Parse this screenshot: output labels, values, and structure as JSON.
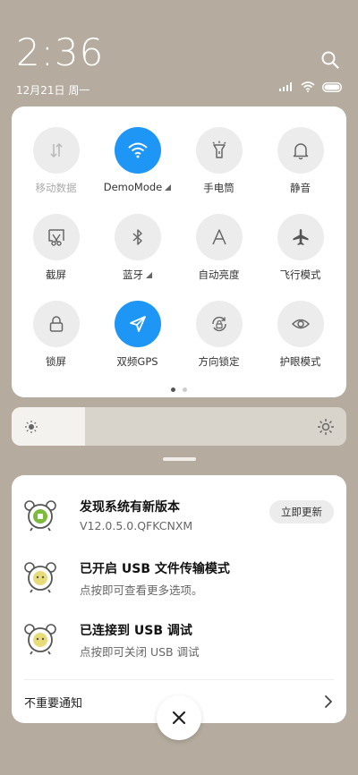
{
  "status": {
    "time": "2:36",
    "date": "12月21日 周一",
    "icons": [
      "signal-icon",
      "wifi-icon",
      "battery-icon"
    ]
  },
  "quick_settings": {
    "tiles": [
      {
        "label": "移动数据",
        "icon": "mobile-data-icon",
        "active": false,
        "disabled": true
      },
      {
        "label": "DemoMode",
        "icon": "wifi-icon",
        "active": true,
        "has_more": true
      },
      {
        "label": "手电筒",
        "icon": "flashlight-icon",
        "active": false
      },
      {
        "label": "静音",
        "icon": "bell-icon",
        "active": false
      },
      {
        "label": "截屏",
        "icon": "screenshot-icon",
        "active": false
      },
      {
        "label": "蓝牙",
        "icon": "bluetooth-icon",
        "active": false,
        "has_more": true
      },
      {
        "label": "自动亮度",
        "icon": "auto-brightness-icon",
        "active": false
      },
      {
        "label": "飞行模式",
        "icon": "airplane-icon",
        "active": false
      },
      {
        "label": "锁屏",
        "icon": "lock-icon",
        "active": false
      },
      {
        "label": "双频GPS",
        "icon": "location-icon",
        "active": true
      },
      {
        "label": "方向锁定",
        "icon": "rotation-lock-icon",
        "active": false
      },
      {
        "label": "护眼模式",
        "icon": "eye-icon",
        "active": false
      }
    ],
    "page_count": 2,
    "current_page": 1
  },
  "brightness": {
    "level": 0.22
  },
  "notifications": {
    "items": [
      {
        "title": "发现系统有新版本",
        "subtitle": "V12.0.5.0.QFKCNXM",
        "action": "立即更新"
      },
      {
        "title": "已开启 USB 文件传输模式",
        "subtitle": "点按即可查看更多选项。"
      },
      {
        "title": "已连接到 USB 调试",
        "subtitle": "点按即可关闭 USB 调试"
      }
    ],
    "unimportant_label": "不重要通知"
  },
  "colors": {
    "accent": "#1e96f5",
    "background": "#b5ac9f"
  }
}
